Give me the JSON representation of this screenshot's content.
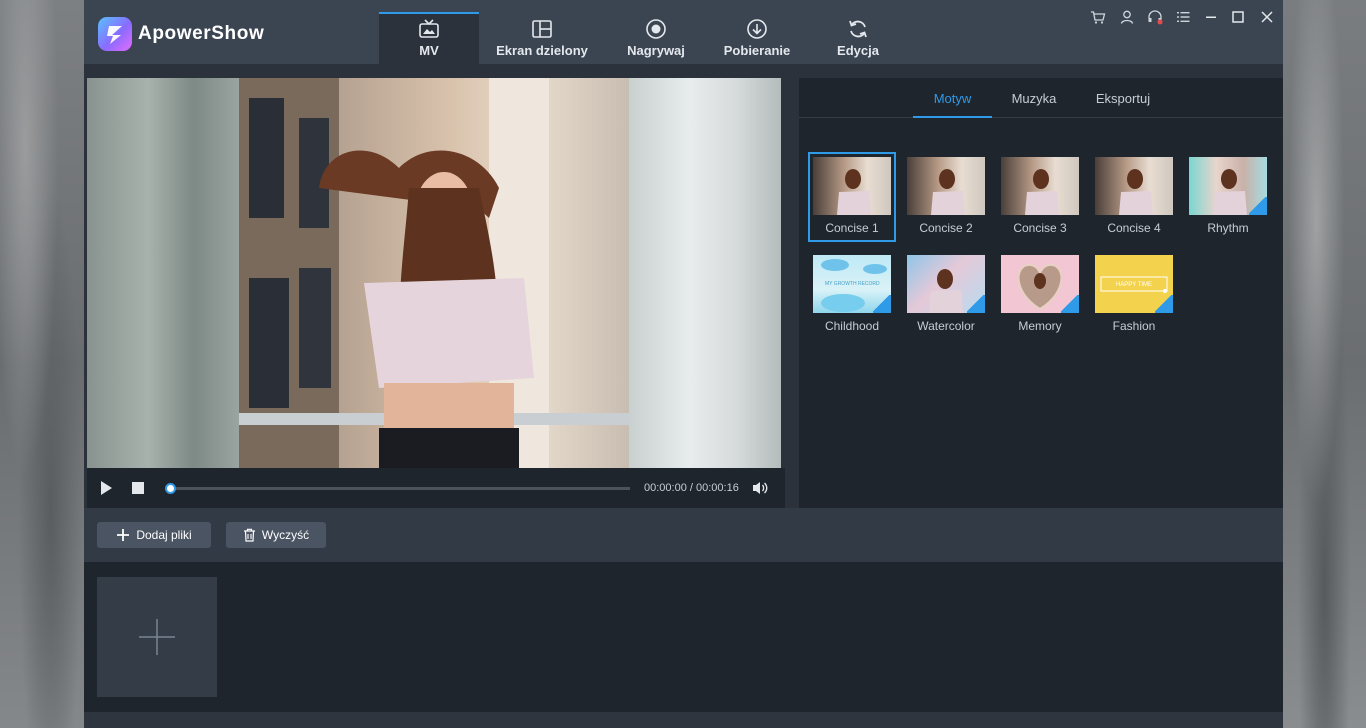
{
  "app": {
    "name": "ApowerShow",
    "accent_color": "#2f9ae8"
  },
  "main_tabs": [
    {
      "label": "MV",
      "icon": "tv-icon",
      "active": true
    },
    {
      "label": "Ekran dzielony",
      "icon": "split-screen-icon",
      "active": false
    },
    {
      "label": "Nagrywaj",
      "icon": "record-icon",
      "active": false
    },
    {
      "label": "Pobieranie",
      "icon": "download-icon",
      "active": false
    },
    {
      "label": "Edycja",
      "icon": "refresh-icon",
      "active": false
    }
  ],
  "window_controls": [
    "cart-icon",
    "user-icon",
    "support-icon",
    "menu-icon",
    "minimize-icon",
    "maximize-icon",
    "close-icon"
  ],
  "player": {
    "time": "00:00:00 / 00:00:16",
    "progress": 0
  },
  "side_panel": {
    "tabs": [
      {
        "label": "Motyw",
        "active": true
      },
      {
        "label": "Muzyka",
        "active": false
      },
      {
        "label": "Eksportuj",
        "active": false
      }
    ],
    "themes": [
      {
        "label": "Concise 1",
        "selected": true,
        "downloadable": false
      },
      {
        "label": "Concise 2",
        "selected": false,
        "downloadable": false
      },
      {
        "label": "Concise 3",
        "selected": false,
        "downloadable": false
      },
      {
        "label": "Concise 4",
        "selected": false,
        "downloadable": false
      },
      {
        "label": "Rhythm",
        "selected": false,
        "downloadable": true
      },
      {
        "label": "Childhood",
        "selected": false,
        "downloadable": true
      },
      {
        "label": "Watercolor",
        "selected": false,
        "downloadable": true
      },
      {
        "label": "Memory",
        "selected": false,
        "downloadable": true
      },
      {
        "label": "Fashion",
        "selected": false,
        "downloadable": true
      }
    ],
    "fashion_thumb_text": "HAPPY TIME",
    "childhood_thumb_text": "MY GROWTH RECORD"
  },
  "toolbar": {
    "add_files": "Dodaj pliki",
    "clear": "Wyczyść"
  }
}
